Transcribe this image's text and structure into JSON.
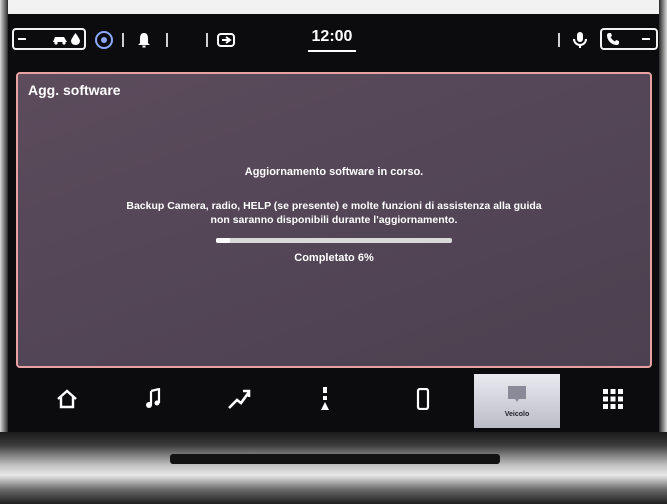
{
  "status_bar": {
    "clock": "12:00",
    "icons": [
      "car-icon",
      "driver-assist-icon",
      "bell-icon",
      "connectivity-icon",
      "microphone-icon",
      "phone-icon"
    ]
  },
  "dialog": {
    "title": "Agg. software",
    "heading": "Aggiornamento software in corso.",
    "body_line1": "Backup Camera, radio, HELP (se presente) e molte funzioni di assistenza alla guida",
    "body_line2": "non saranno disponibili durante l'aggiornamento.",
    "progress_percent": 6,
    "progress_label": "Completato 6%"
  },
  "nav": {
    "items": [
      {
        "name": "home-icon",
        "label": ""
      },
      {
        "name": "music-icon",
        "label": ""
      },
      {
        "name": "navigation-icon",
        "label": ""
      },
      {
        "name": "climate-icon",
        "label": ""
      },
      {
        "name": "phone-icon",
        "label": ""
      },
      {
        "name": "vehicle-icon",
        "label": "Veicolo",
        "active": true
      },
      {
        "name": "apps-grid-icon",
        "label": ""
      }
    ]
  },
  "colors": {
    "panel_border": "#e8a3a0",
    "panel_bg": "#544657",
    "active_tab": "#d9d9e2"
  }
}
